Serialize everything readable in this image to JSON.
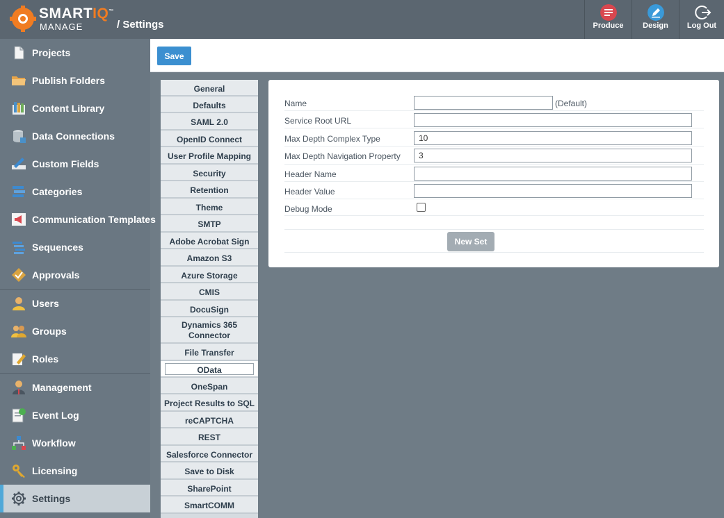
{
  "header": {
    "brand_smart": "SMART",
    "brand_iq": "IQ",
    "brand_tm": "™",
    "brand_manage": "MANAGE",
    "page_title": "/ Settings",
    "buttons": {
      "produce": "Produce",
      "design": "Design",
      "logout": "Log Out"
    }
  },
  "sidebar": {
    "items": [
      {
        "label": "Projects",
        "icon": "document-icon"
      },
      {
        "label": "Publish Folders",
        "icon": "folder-icon"
      },
      {
        "label": "Content Library",
        "icon": "library-icon"
      },
      {
        "label": "Data Connections",
        "icon": "database-icon"
      },
      {
        "label": "Custom Fields",
        "icon": "pencil-ruler-icon"
      },
      {
        "label": "Categories",
        "icon": "categories-icon"
      },
      {
        "label": "Communication Templates",
        "icon": "megaphone-icon"
      },
      {
        "label": "Sequences",
        "icon": "sequences-icon"
      },
      {
        "label": "Approvals",
        "icon": "approvals-icon"
      },
      {
        "label": "Users",
        "icon": "user-icon"
      },
      {
        "label": "Groups",
        "icon": "group-icon"
      },
      {
        "label": "Roles",
        "icon": "roles-icon"
      },
      {
        "label": "Management",
        "icon": "manager-icon"
      },
      {
        "label": "Event Log",
        "icon": "event-log-icon"
      },
      {
        "label": "Workflow",
        "icon": "workflow-icon"
      },
      {
        "label": "Licensing",
        "icon": "key-icon"
      },
      {
        "label": "Settings",
        "icon": "gear-icon"
      }
    ],
    "active": "Settings"
  },
  "toolbar": {
    "save_label": "Save"
  },
  "settings_menu": {
    "items": [
      "General",
      "Defaults",
      "SAML 2.0",
      "OpenID Connect",
      "User Profile Mapping",
      "Security",
      "Retention",
      "Theme",
      "SMTP",
      "Adobe Acrobat Sign",
      "Amazon S3",
      "Azure Storage",
      "CMIS",
      "DocuSign",
      "Dynamics 365|Connector",
      "File Transfer",
      "OData",
      "OneSpan",
      "Project Results to SQL",
      "reCAPTCHA",
      "REST",
      "Salesforce Connector",
      "Save to Disk",
      "SharePoint",
      "SmartCOMM"
    ],
    "active": "OData"
  },
  "form": {
    "name_label": "Name",
    "name_value": "",
    "default_tag": "(Default)",
    "service_root_label": "Service Root URL",
    "service_root_value": "",
    "max_complex_label": "Max Depth Complex Type",
    "max_complex_value": "10",
    "max_nav_label": "Max Depth Navigation Property",
    "max_nav_value": "3",
    "header_name_label": "Header Name",
    "header_name_value": "",
    "header_value_label": "Header Value",
    "header_value_value": "",
    "debug_label": "Debug Mode",
    "debug_checked": false,
    "new_set_label": "New Set"
  },
  "colors": {
    "topbar": "#5b6670",
    "sidebar": "#6a7782",
    "accent_orange": "#f07c22",
    "save_blue": "#3b8fd0",
    "produce_red": "#d9474f",
    "design_blue": "#3a9ad9"
  }
}
